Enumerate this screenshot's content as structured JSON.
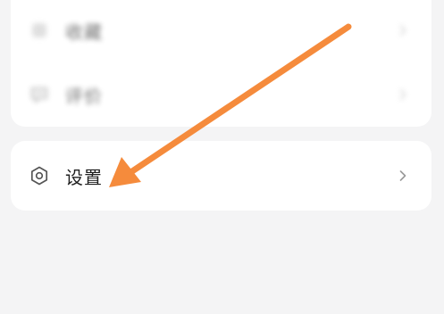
{
  "menu": {
    "items": [
      {
        "label": "收藏",
        "icon": "bookmark-icon",
        "blurred": true
      },
      {
        "label": "评价",
        "icon": "comment-icon",
        "blurred": true
      }
    ]
  },
  "settings": {
    "label": "设置",
    "icon": "gear-icon"
  },
  "annotation": {
    "arrow_color": "#f58b3c",
    "points_to": "settings"
  },
  "colors": {
    "background": "#f4f4f5",
    "card": "#ffffff",
    "text": "#1f1f1f",
    "icon": "#555555",
    "chevron": "#9a9a9a"
  }
}
